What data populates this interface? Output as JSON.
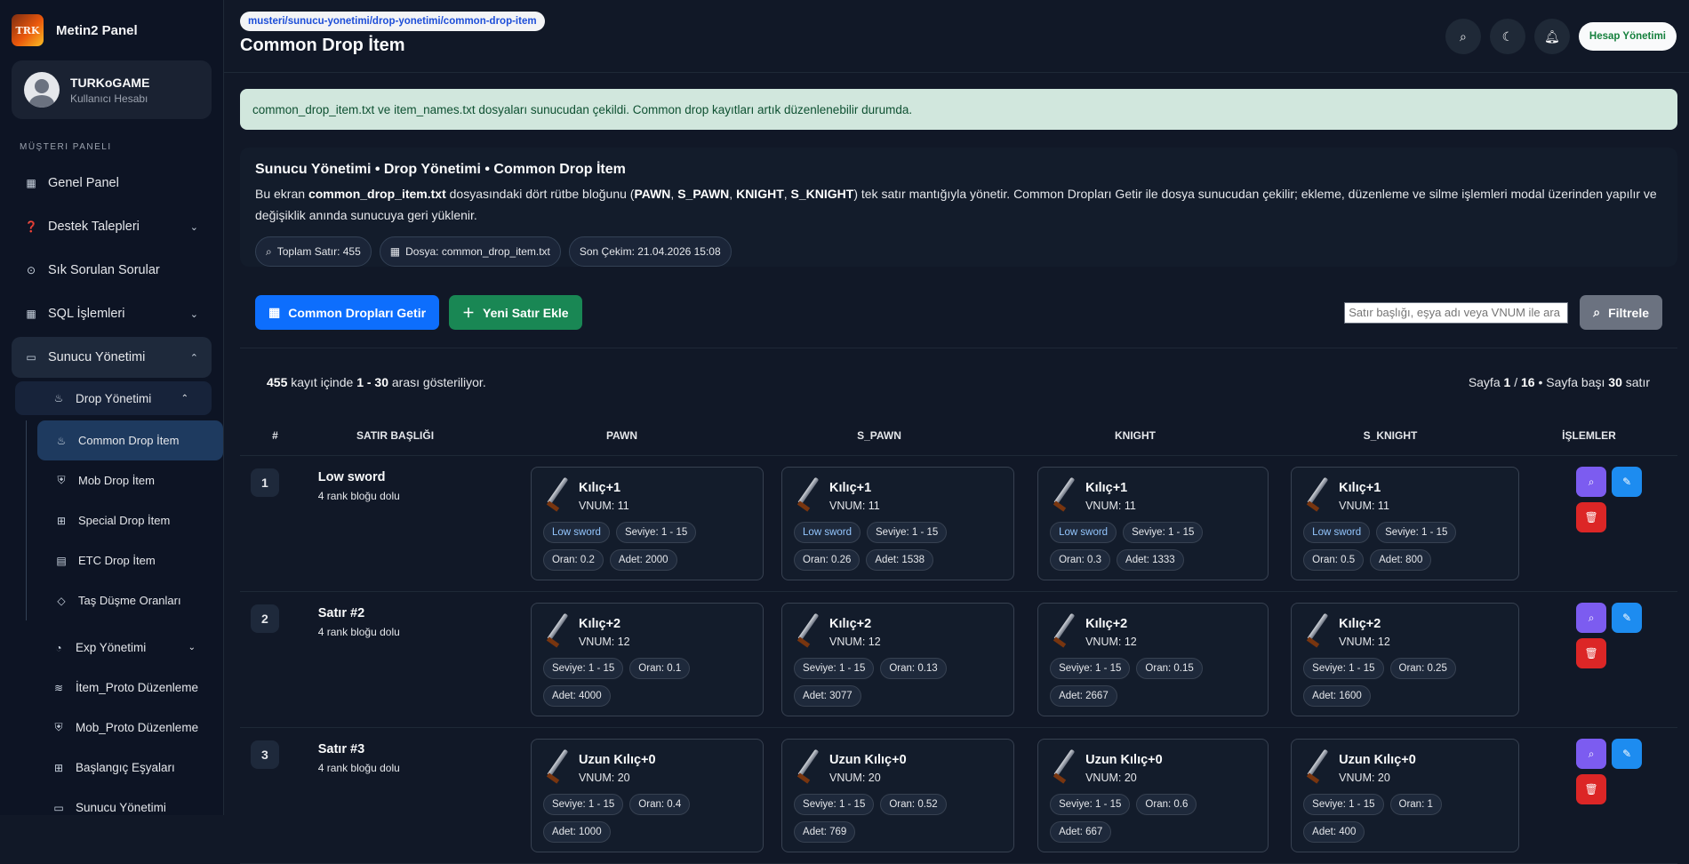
{
  "brand": {
    "name": "Metin2 Panel",
    "logo_text": "TRK"
  },
  "user": {
    "name": "TURKoGAME",
    "subtitle": "Kullanıcı Hesabı"
  },
  "sidebar": {
    "section_title": "Müşteri Paneli",
    "items": [
      {
        "label": "Genel Panel",
        "icon": "grid-icon"
      },
      {
        "label": "Destek Talepleri",
        "icon": "question-icon"
      },
      {
        "label": "Sık Sorulan Sorular",
        "icon": "help-circle-icon"
      },
      {
        "label": "SQL İşlemleri",
        "icon": "grid-icon"
      },
      {
        "label": "Sunucu Yönetimi",
        "icon": "monitor-icon"
      }
    ],
    "drop_menu": {
      "label": "Drop Yönetimi",
      "icon": "flame-icon"
    },
    "drop_children": [
      {
        "label": "Common Drop İtem",
        "icon": "flame-icon"
      },
      {
        "label": "Mob Drop İtem",
        "icon": "shield-icon"
      },
      {
        "label": "Special Drop İtem",
        "icon": "gift-icon"
      },
      {
        "label": "ETC Drop İtem",
        "icon": "file-icon"
      },
      {
        "label": "Taş Düşme Oranları",
        "icon": "gem-icon"
      }
    ],
    "more": [
      {
        "label": "Exp Yönetimi",
        "icon": "chart-icon"
      },
      {
        "label": "İtem_Proto Düzenleme",
        "icon": "layers-icon"
      },
      {
        "label": "Mob_Proto Düzenleme",
        "icon": "shield-icon"
      },
      {
        "label": "Başlangıç Eşyaları",
        "icon": "gift-icon"
      },
      {
        "label": "Sunucu Yönetimi",
        "icon": "monitor-icon"
      }
    ]
  },
  "header": {
    "breadcrumb": "musteri/sunucu-yonetimi/drop-yonetimi/common-drop-item",
    "title": "Common Drop İtem",
    "account_button": "Hesap Yönetimi"
  },
  "alert": "common_drop_item.txt ve item_names.txt dosyaları sunucudan çekildi. Common drop kayıtları artık düzenlenebilir durumda.",
  "info": {
    "heading": "Sunucu Yönetimi • Drop Yönetimi • Common Drop İtem",
    "p1": "Bu ekran ",
    "file": "common_drop_item.txt",
    "p2": " dosyasındaki dört rütbe bloğunu (",
    "r1": "PAWN",
    "sep1": ", ",
    "r2": "S_PAWN",
    "sep2": ", ",
    "r3": "KNIGHT",
    "sep3": ", ",
    "r4": "S_KNIGHT",
    "p3": ") tek satır mantığıyla yönetir. Common Dropları Getir ile dosya sunucudan çekilir; ekleme, düzenleme ve silme işlemleri modal üzerinden yapılır ve değişiklik anında sunucuya geri yüklenir.",
    "chips": [
      "Toplam Satır: 455",
      "Dosya: common_drop_item.txt",
      "Son Çekim: 21.04.2026 15:08"
    ]
  },
  "toolbar": {
    "fetch": "Common Dropları Getir",
    "add": "Yeni Satır Ekle",
    "search_placeholder": "Satır başlığı, eşya adı veya VNUM ile ara",
    "filter": "Filtrele"
  },
  "summary": {
    "total": "455",
    "left_text": " kayıt içinde ",
    "range": "1 - 30",
    "right_text": " arası gösteriliyor.",
    "page_label": "Sayfa ",
    "page": "1",
    "page_sep": " / ",
    "pages": "16",
    "per_label": " • Sayfa başı ",
    "per": "30",
    "per_unit": " satır"
  },
  "columns": [
    "#",
    "SATIR BAŞLIĞI",
    "PAWN",
    "S_PAWN",
    "KNIGHT",
    "S_KNIGHT",
    "İŞLEMLER"
  ],
  "rows": [
    {
      "num": "1",
      "title": "Low sword",
      "sub": "4 rank bloğu dolu",
      "cells": [
        {
          "name": "Kılıç+1",
          "vnum": "VNUM: 11",
          "tags": [
            "Low sword",
            "Seviye: 1 - 15",
            "Oran: 0.2",
            "Adet: 2000"
          ]
        },
        {
          "name": "Kılıç+1",
          "vnum": "VNUM: 11",
          "tags": [
            "Low sword",
            "Seviye: 1 - 15",
            "Oran: 0.26",
            "Adet: 1538"
          ]
        },
        {
          "name": "Kılıç+1",
          "vnum": "VNUM: 11",
          "tags": [
            "Low sword",
            "Seviye: 1 - 15",
            "Oran: 0.3",
            "Adet: 1333"
          ]
        },
        {
          "name": "Kılıç+1",
          "vnum": "VNUM: 11",
          "tags": [
            "Low sword",
            "Seviye: 1 - 15",
            "Oran: 0.5",
            "Adet: 800"
          ]
        }
      ]
    },
    {
      "num": "2",
      "title": "Satır #2",
      "sub": "4 rank bloğu dolu",
      "cells": [
        {
          "name": "Kılıç+2",
          "vnum": "VNUM: 12",
          "tags": [
            "Seviye: 1 - 15",
            "Oran: 0.1",
            "Adet: 4000"
          ]
        },
        {
          "name": "Kılıç+2",
          "vnum": "VNUM: 12",
          "tags": [
            "Seviye: 1 - 15",
            "Oran: 0.13",
            "Adet: 3077"
          ]
        },
        {
          "name": "Kılıç+2",
          "vnum": "VNUM: 12",
          "tags": [
            "Seviye: 1 - 15",
            "Oran: 0.15",
            "Adet: 2667"
          ]
        },
        {
          "name": "Kılıç+2",
          "vnum": "VNUM: 12",
          "tags": [
            "Seviye: 1 - 15",
            "Oran: 0.25",
            "Adet: 1600"
          ]
        }
      ]
    },
    {
      "num": "3",
      "title": "Satır #3",
      "sub": "4 rank bloğu dolu",
      "cells": [
        {
          "name": "Uzun Kılıç+0",
          "vnum": "VNUM: 20",
          "tags": [
            "Seviye: 1 - 15",
            "Oran: 0.4",
            "Adet: 1000"
          ]
        },
        {
          "name": "Uzun Kılıç+0",
          "vnum": "VNUM: 20",
          "tags": [
            "Seviye: 1 - 15",
            "Oran: 0.52",
            "Adet: 769"
          ]
        },
        {
          "name": "Uzun Kılıç+0",
          "vnum": "VNUM: 20",
          "tags": [
            "Seviye: 1 - 15",
            "Oran: 0.6",
            "Adet: 667"
          ]
        },
        {
          "name": "Uzun Kılıç+0",
          "vnum": "VNUM: 20",
          "tags": [
            "Seviye: 1 - 15",
            "Oran: 1",
            "Adet: 400"
          ]
        }
      ]
    }
  ]
}
